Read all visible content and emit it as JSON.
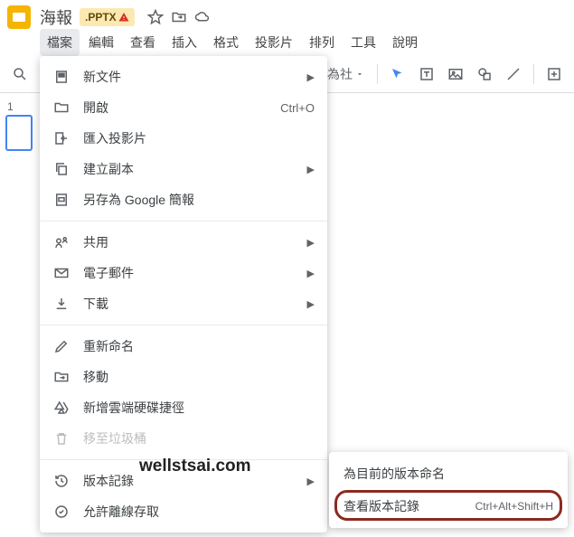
{
  "header": {
    "title": "海報",
    "badge": ".PPTX"
  },
  "menubar": [
    "檔案",
    "編輯",
    "查看",
    "插入",
    "格式",
    "投影片",
    "排列",
    "工具",
    "說明"
  ],
  "toolbar": {
    "theme_label": "為社"
  },
  "thumb": {
    "num": "1"
  },
  "menu": {
    "new_doc": "新文件",
    "open": "開啟",
    "open_sc": "Ctrl+O",
    "import": "匯入投影片",
    "copy": "建立副本",
    "save_as": "另存為 Google 簡報",
    "share": "共用",
    "email": "電子郵件",
    "download": "下載",
    "rename": "重新命名",
    "move": "移動",
    "drive_shortcut": "新增雲端硬碟捷徑",
    "trash": "移至垃圾桶",
    "version": "版本記錄",
    "offline": "允許離線存取"
  },
  "submenu": {
    "name_current": "為目前的版本命名",
    "see_history": "查看版本記錄",
    "see_history_sc": "Ctrl+Alt+Shift+H"
  },
  "watermark": "wellstsai.com"
}
